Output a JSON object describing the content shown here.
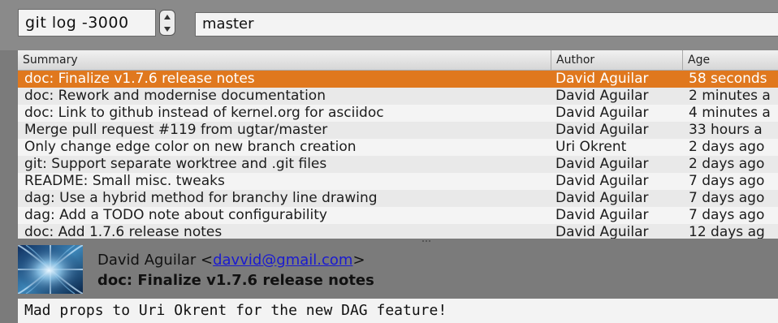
{
  "toolbar": {
    "revision": "git log -3000",
    "branch": "master"
  },
  "log": {
    "columns": {
      "summary": "Summary",
      "author": "Author",
      "age": "Age"
    },
    "rows": [
      {
        "summary": "doc: Finalize v1.7.6 release notes",
        "author": "David Aguilar",
        "age": "58 seconds",
        "selected": true
      },
      {
        "summary": "doc: Rework and modernise documentation",
        "author": "David Aguilar",
        "age": "2 minutes a"
      },
      {
        "summary": "doc: Link to github instead of kernel.org for asciidoc",
        "author": "David Aguilar",
        "age": "4 minutes a"
      },
      {
        "summary": "Merge pull request #119 from ugtar/master",
        "author": "David Aguilar",
        "age": "33 hours a"
      },
      {
        "summary": "Only change edge color on new branch creation",
        "author": "Uri Okrent",
        "age": "2 days ago"
      },
      {
        "summary": "git: Support separate worktree and .git files",
        "author": "David Aguilar",
        "age": "2 days ago"
      },
      {
        "summary": "README: Small misc. tweaks",
        "author": "David Aguilar",
        "age": "7 days ago"
      },
      {
        "summary": "dag: Use a hybrid method for branchy line drawing",
        "author": "David Aguilar",
        "age": "7 days ago"
      },
      {
        "summary": "dag: Add a TODO note about configurability",
        "author": "David Aguilar",
        "age": "7 days ago"
      },
      {
        "summary": "doc: Add 1.7.6 release notes",
        "author": "David Aguilar",
        "age": "12 days ag"
      }
    ]
  },
  "commit": {
    "author_name": "David Aguilar",
    "email": "davvid@gmail.com",
    "subject": "doc: Finalize v1.7.6 release notes",
    "message": "Mad props to Uri Okrent for the new DAG feature!"
  },
  "icons": [
    "spinner-up-icon",
    "spinner-down-icon",
    "splitter-grip-icon"
  ],
  "colors": {
    "selection": "#e0781e",
    "link": "#1a1ad0",
    "chrome": "#7b7b7b"
  }
}
